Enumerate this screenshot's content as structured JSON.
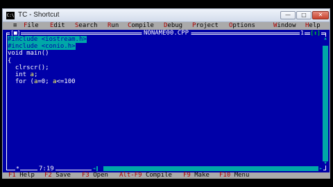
{
  "window": {
    "title": "TC - Shortcut",
    "icon_name": "console-icon",
    "icon_text": "C:\\",
    "buttons": {
      "minimize": "—",
      "maximize": "□",
      "close": "✕"
    }
  },
  "menu": {
    "system": "≡",
    "items": [
      {
        "key": "F",
        "rest": "ile"
      },
      {
        "key": "E",
        "rest": "dit"
      },
      {
        "key": "S",
        "rest": "earch"
      },
      {
        "key": "R",
        "rest": "un"
      },
      {
        "key": "C",
        "rest": "ompile"
      },
      {
        "key": "D",
        "rest": "ebug"
      },
      {
        "key": "P",
        "rest": "roject"
      },
      {
        "key": "O",
        "rest": "ptions"
      },
      {
        "key": "W",
        "rest": "indow"
      },
      {
        "key": "H",
        "rest": "elp"
      }
    ]
  },
  "editor": {
    "close_box": "[■]",
    "file_name": "NONAME00.CPP",
    "window_number": "1",
    "zoom_box": "[↕]",
    "modified_marker": "*",
    "cursor_position": "7:19",
    "lines": {
      "l1": "#include <iostream.h>",
      "l2": "#include <conio.h>",
      "l3": "void main()",
      "l4": "{",
      "l5": "  clrscr();",
      "l6a": "  int ",
      "l6b": "a",
      "l6c": ";",
      "l7a": "  for (",
      "l7b": "a",
      "l7c": "=0; ",
      "l7d": "a",
      "l7e": "<=100"
    }
  },
  "status": {
    "items": [
      {
        "key": "F1",
        "label": "Help"
      },
      {
        "key": "F2",
        "label": "Save"
      },
      {
        "key": "F3",
        "label": "Open"
      },
      {
        "key": "Alt-F9",
        "label": "Compile"
      },
      {
        "key": "F9",
        "label": "Make"
      },
      {
        "key": "F10",
        "label": "Menu"
      }
    ]
  },
  "colors": {
    "editor_bg": "#0000a8",
    "menu_bg": "#aaaaaa",
    "hotkey": "#a80000",
    "selection": "#00a8a8"
  }
}
